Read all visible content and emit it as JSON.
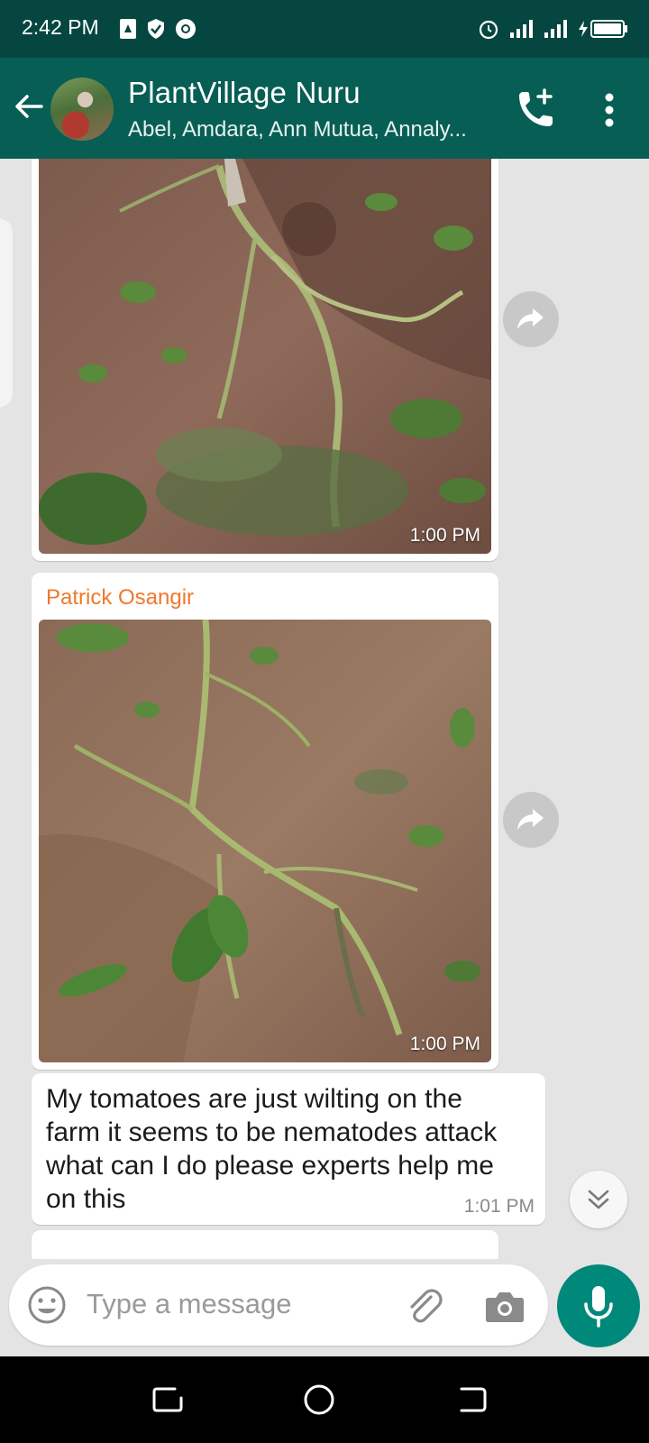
{
  "status_bar": {
    "time": "2:42 PM",
    "left_icons": [
      "drive-icon",
      "shield-icon",
      "chrome-icon"
    ],
    "right_icons": [
      "alarm-icon",
      "signal-icon",
      "signal-icon",
      "battery-charging-icon"
    ]
  },
  "header": {
    "title": "PlantVillage Nuru",
    "subtitle": "Abel, Amdara, Ann Mutua, Annaly...",
    "call_icon": "add-call-icon",
    "menu_icon": "more-vert-icon"
  },
  "messages": [
    {
      "type": "image",
      "sender": "",
      "time": "1:00 PM",
      "image": "wilted tomato plant uprooted on soil"
    },
    {
      "type": "image",
      "sender": "Patrick Osangir",
      "sender_color": "#f0782c",
      "time": "1:00 PM",
      "image": "wilted tomato plant lying on soil"
    },
    {
      "type": "text",
      "text": "My tomatoes are just wilting on the farm it seems to be nematodes attack what can I do please experts help me on this",
      "time": "1:01 PM"
    }
  ],
  "composer": {
    "placeholder": "Type a message",
    "icons": [
      "emoji-icon",
      "attach-icon",
      "camera-icon",
      "mic-icon"
    ]
  },
  "colors": {
    "header": "#075e54",
    "status_bar": "#054640",
    "chat_bg": "#e4e4e4",
    "accent": "#00897b",
    "sender_name": "#f0782c"
  }
}
